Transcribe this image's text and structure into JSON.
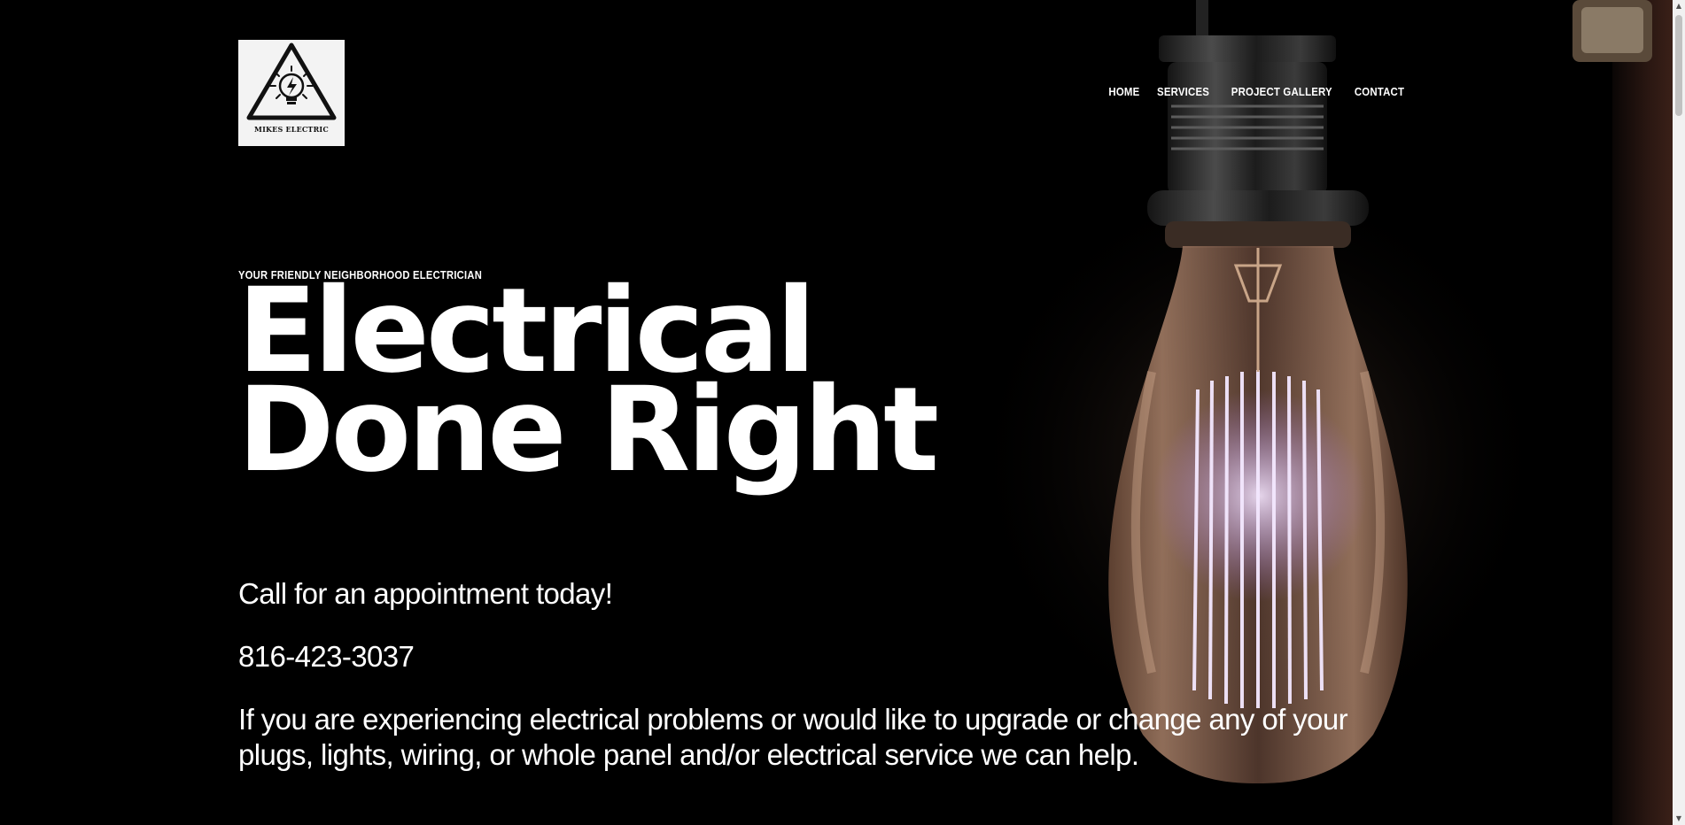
{
  "logo": {
    "text": "MIKES ELECTRIC",
    "icon": "lightbulb-warning-triangle-icon"
  },
  "nav": {
    "items": [
      {
        "label": "HOME"
      },
      {
        "label": "SERVICES"
      },
      {
        "label": "PROJECT GALLERY"
      },
      {
        "label": "CONTACT"
      }
    ]
  },
  "hero": {
    "eyebrow": "YOUR FRIENDLY NEIGHBORHOOD ELECTRICIAN",
    "headline": "Electrical Done Right",
    "cta": "Call for an appointment today!",
    "phone": "816-423-3037",
    "description": "If you are experiencing electrical problems or would like to upgrade or change any of your plugs, lights, wiring, or whole panel and/or electrical service we can help."
  },
  "background": {
    "icon": "edison-bulb-photo",
    "colors": {
      "page": "#000000",
      "glass": "#b08a70",
      "filament": "#e8d2ff"
    }
  },
  "scrollbar": {
    "up_icon": "triangle-up-icon",
    "down_icon": "triangle-down-icon"
  }
}
